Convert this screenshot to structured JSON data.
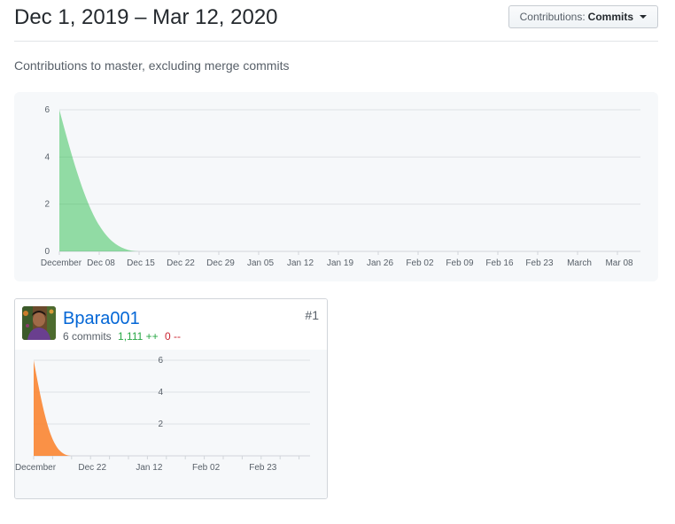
{
  "header": {
    "date_range": "Dec 1, 2019 – Mar 12, 2020",
    "contrib_label": "Contributions:",
    "contrib_value": "Commits"
  },
  "subtitle": "Contributions to master, excluding merge commits",
  "chart_data": [
    {
      "type": "area",
      "color": "#2cbe4e",
      "x_tick_labels": [
        "December",
        "Dec 08",
        "Dec 15",
        "Dec 22",
        "Dec 29",
        "Jan 05",
        "Jan 12",
        "Jan 19",
        "Jan 26",
        "Feb 02",
        "Feb 09",
        "Feb 16",
        "Feb 23",
        "March",
        "Mar 08"
      ],
      "y_tick_labels": [
        "0",
        "2",
        "4",
        "6"
      ],
      "ylim": [
        0,
        6
      ],
      "x": [
        "Dec 1",
        "Dec 8",
        "Dec 15"
      ],
      "values": [
        6,
        0,
        0
      ],
      "grid": true
    },
    {
      "type": "area",
      "color": "#fb8532",
      "x_tick_labels": [
        "December",
        "Dec 22",
        "Jan 12",
        "Feb 02",
        "Feb 23"
      ],
      "y_tick_labels": [
        "2",
        "4",
        "6"
      ],
      "ylim": [
        0,
        6
      ],
      "x": [
        "Dec 1",
        "Dec 8",
        "Dec 15"
      ],
      "values": [
        6,
        0,
        0
      ],
      "grid": true
    }
  ],
  "contributor": {
    "username": "Bpara001",
    "commits": "6 commits",
    "additions": "1,111 ++",
    "deletions": "0 --",
    "rank": "#1",
    "avatar": "avatar-photo"
  }
}
